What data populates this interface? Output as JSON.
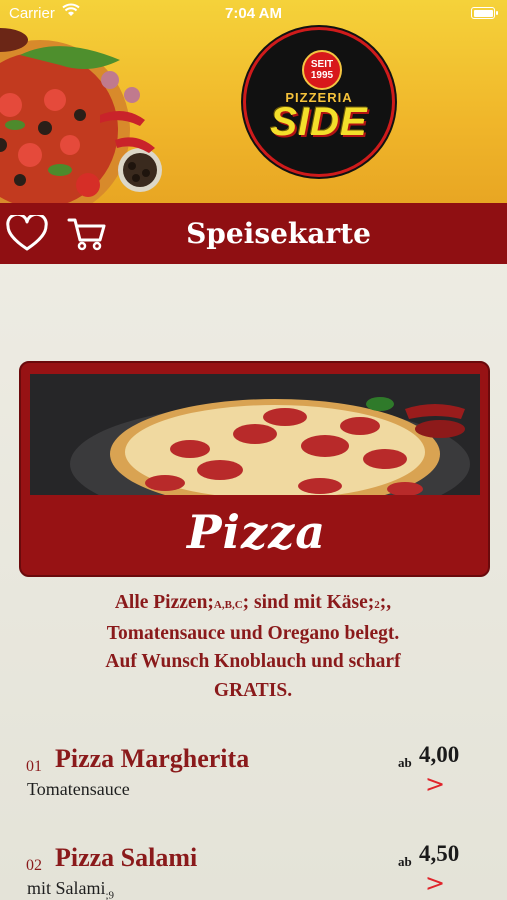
{
  "status_bar": {
    "carrier": "Carrier",
    "time": "7:04 AM"
  },
  "logo": {
    "seit_line1": "SEIT",
    "seit_line2": "1995",
    "pizzeria": "PIZZERIA",
    "side": "SIDE"
  },
  "navbar": {
    "title": "Speisekarte",
    "favorites_icon": "heart-icon",
    "cart_icon": "cart-icon"
  },
  "category": {
    "label": "Pizza"
  },
  "description": {
    "line1_a": "Alle Pizzen;",
    "line1_allergen1": "A,B,C",
    "line1_b": "; sind mit Käse;",
    "line1_allergen2": "2",
    "line1_c": ";,",
    "line2": "Tomatensauce und Oregano belegt.",
    "line3": "Auf Wunsch Knoblauch und scharf",
    "line4": "GRATIS."
  },
  "items": [
    {
      "number": "01",
      "name": "Pizza Margherita",
      "description": "Tomatensauce",
      "allergen": "",
      "price_prefix": "ab",
      "price": "4,00",
      "arrow": ">"
    },
    {
      "number": "02",
      "name": "Pizza Salami",
      "description": "mit Salami",
      "allergen": ";9",
      "price_prefix": "ab",
      "price": "4,50",
      "arrow": ">"
    }
  ],
  "colors": {
    "brand_red": "#8f0f12",
    "text_red": "#8a1a1b",
    "arrow_red": "#e0242b",
    "banner_yellow": "#f5d23a"
  }
}
